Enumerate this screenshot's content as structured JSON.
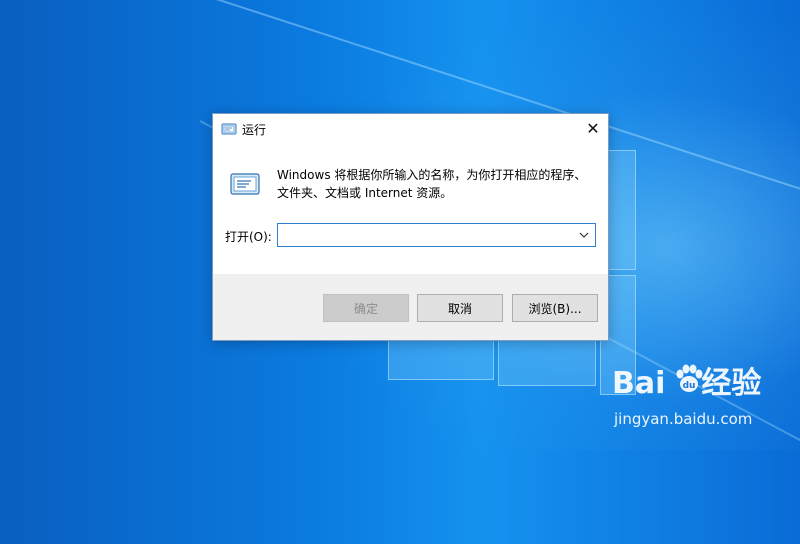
{
  "dialog": {
    "title": "运行",
    "description_line1": "Windows 将根据你所输入的名称，为你打开相应的程序、",
    "description_line2": "文件夹、文档或 Internet 资源。",
    "open_label": "打开(O):",
    "open_value": "",
    "buttons": {
      "ok": "确定",
      "cancel": "取消",
      "browse": "浏览(B)..."
    }
  },
  "watermark": {
    "brand_left": "Bai",
    "brand_right": "经验",
    "url": "jingyan.baidu.com"
  },
  "icons": [
    "run-icon",
    "close-icon",
    "chevron-down-icon",
    "baidu-paw-icon"
  ],
  "colors": {
    "desktop_blue": "#0b7be0",
    "field_border": "#2f7fd1",
    "footer_bg": "#f0f0f0"
  }
}
